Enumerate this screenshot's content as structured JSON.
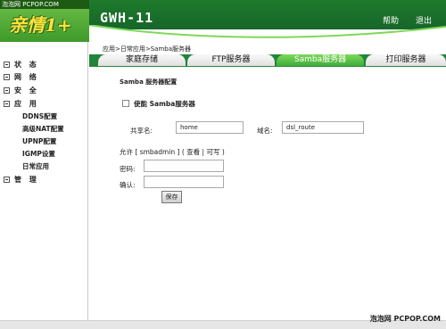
{
  "watermark_top": "泡泡网 PCPOP.COM",
  "watermark_bottom": "泡泡网 PCPOP.COM",
  "logo_text": "亲情1+",
  "model": "GWH-11",
  "top_links": {
    "help": "帮助",
    "logout": "退出"
  },
  "sidebar": {
    "items": [
      {
        "label": "状 态"
      },
      {
        "label": "网 络"
      },
      {
        "label": "安 全"
      },
      {
        "label": "应 用"
      },
      {
        "label": "管 理"
      }
    ],
    "app_subitems": [
      {
        "label": "DDNS配置"
      },
      {
        "label": "高级NAT配置"
      },
      {
        "label": "UPNP配置"
      },
      {
        "label": "IGMP设置"
      },
      {
        "label": "日常应用"
      }
    ]
  },
  "breadcrumb": "应用>日常应用>Samba服务器",
  "tabs": [
    {
      "label": "家庭存储",
      "active": false
    },
    {
      "label": "FTP服务器",
      "active": false
    },
    {
      "label": "Samba服务器",
      "active": true
    },
    {
      "label": "打印服务器",
      "active": false
    }
  ],
  "section_title": "Samba 服务器配置",
  "enable_label": "使能 Samba服务器",
  "enable_checked": false,
  "share_name": {
    "label": "共享名:",
    "value": "home"
  },
  "domain": {
    "label": "域名:",
    "value": "dsl_route"
  },
  "allow_line": "允许 [ smbadmin ] ( 查看 | 可写 )",
  "password": {
    "label": "密码:",
    "value": ""
  },
  "confirm": {
    "label": "确认:",
    "value": ""
  },
  "save_label": "保存",
  "colors": {
    "header_green": "#1f7a2c",
    "tab_active": "#3aa83a",
    "logo_yellow": "#ffe23d"
  }
}
